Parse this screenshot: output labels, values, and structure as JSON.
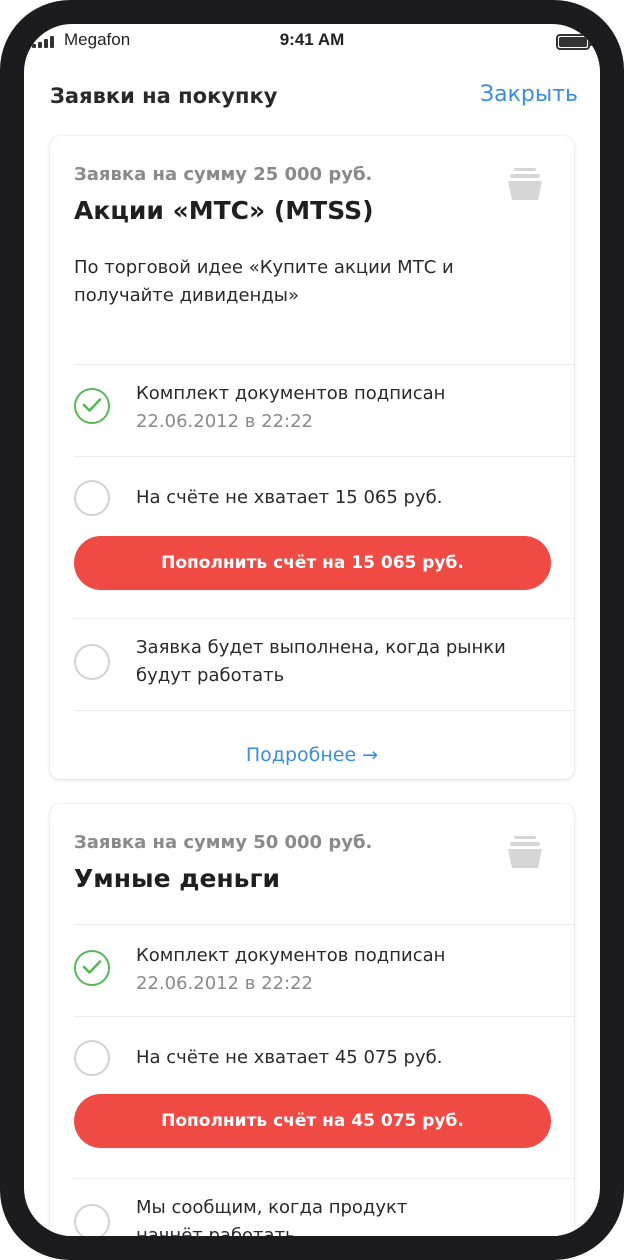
{
  "status_bar": {
    "carrier": "Megafon",
    "time": "9:41 AM"
  },
  "header": {
    "title": "Заявки на покупку",
    "close_label": "Закрыть"
  },
  "orders": [
    {
      "sum": "Заявка на сумму 25 000 руб.",
      "title": "Акции «МТС» (MTSS)",
      "description": "По торговой идее «Купите акции МТС и получайте дивиденды»",
      "steps": [
        {
          "status": "done",
          "text": "Комплект документов подписан",
          "date": "22.06.2012 в 22:22"
        },
        {
          "status": "pending",
          "text": "На счёте не хватает 15 065 руб."
        },
        {
          "status": "pending",
          "text": "Заявка будет выполнена, когда рынки будут работать"
        }
      ],
      "pay_label": "Пополнить счёт на 15 065 руб.",
      "more_label": "Подробнее →"
    },
    {
      "sum": "Заявка на сумму 50 000 руб.",
      "title": "Умные деньги",
      "steps": [
        {
          "status": "done",
          "text": "Комплект документов подписан",
          "date": "22.06.2012 в 22:22"
        },
        {
          "status": "pending",
          "text": "На счёте не хватает 45 075 руб."
        },
        {
          "status": "pending",
          "text": "Мы сообщим, когда продукт начнёт работать"
        }
      ],
      "pay_label": "Пополнить счёт на 45 075 руб."
    }
  ],
  "colors": {
    "accent": "#3b8de0",
    "button": "#ef4a44",
    "done": "#58b858",
    "muted": "#8a8a8a"
  },
  "icons": {
    "basket": "basket-icon",
    "check": "check-circle-icon",
    "pending": "empty-circle-icon"
  }
}
